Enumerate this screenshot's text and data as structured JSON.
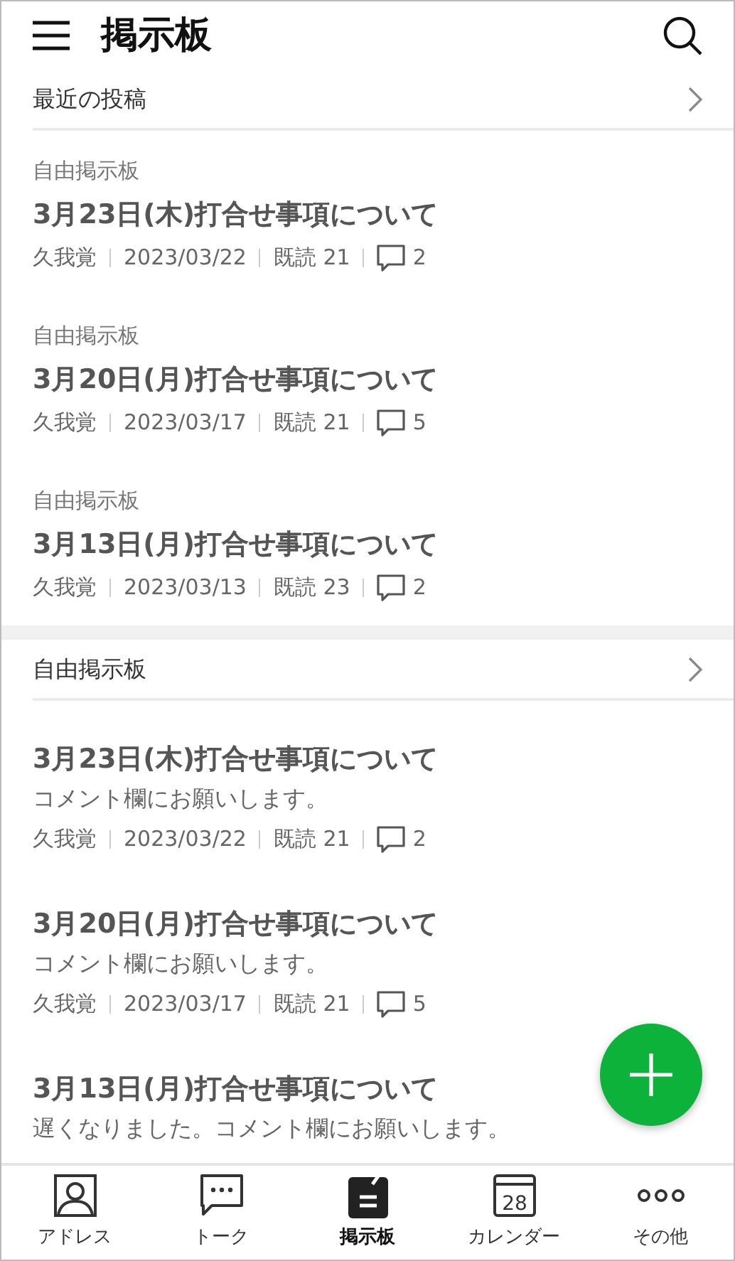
{
  "header": {
    "title": "掲示板"
  },
  "sections": [
    {
      "title": "最近の投稿",
      "posts": [
        {
          "category": "自由掲示板",
          "title": "3月23日(木)打合せ事項について",
          "author": "久我覚",
          "date": "2023/03/22",
          "reads": "既読 21",
          "comments": "2"
        },
        {
          "category": "自由掲示板",
          "title": "3月20日(月)打合せ事項について",
          "author": "久我覚",
          "date": "2023/03/17",
          "reads": "既読 21",
          "comments": "5"
        },
        {
          "category": "自由掲示板",
          "title": "3月13日(月)打合せ事項について",
          "author": "久我覚",
          "date": "2023/03/13",
          "reads": "既読 23",
          "comments": "2"
        }
      ]
    },
    {
      "title": "自由掲示板",
      "posts": [
        {
          "title": "3月23日(木)打合せ事項について",
          "body": "コメント欄にお願いします。",
          "author": "久我覚",
          "date": "2023/03/22",
          "reads": "既読 21",
          "comments": "2"
        },
        {
          "title": "3月20日(月)打合せ事項について",
          "body": "コメント欄にお願いします。",
          "author": "久我覚",
          "date": "2023/03/17",
          "reads": "既読 21",
          "comments": "5"
        },
        {
          "title": "3月13日(月)打合せ事項について",
          "body": "遅くなりました。コメント欄にお願いします。"
        }
      ]
    }
  ],
  "tabs": [
    {
      "kind": "contacts",
      "label": "アドレス",
      "selected": false
    },
    {
      "kind": "talk",
      "label": "トーク",
      "selected": false
    },
    {
      "kind": "board",
      "label": "掲示板",
      "selected": true
    },
    {
      "kind": "calendar",
      "label": "カレンダー",
      "calendar_day": "28",
      "selected": false
    },
    {
      "kind": "more",
      "label": "その他",
      "selected": false
    }
  ]
}
